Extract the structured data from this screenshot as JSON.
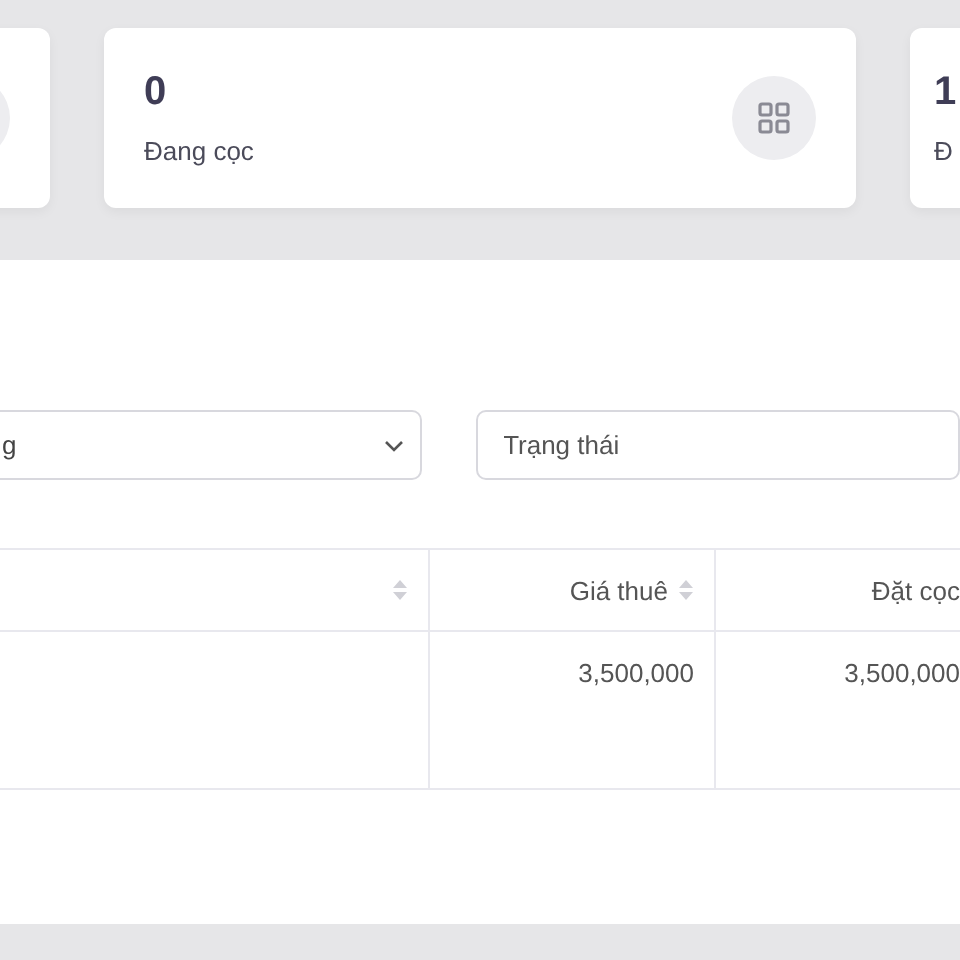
{
  "stat_cards": [
    {
      "kind": "icon_only"
    },
    {
      "kind": "with_icon",
      "value": "0",
      "label": "Đang cọc"
    },
    {
      "kind": "text_only",
      "value": "1",
      "label": "Đ"
    }
  ],
  "filters": [
    {
      "kind": "select",
      "value": "g"
    },
    {
      "kind": "input",
      "placeholder": "Trạng thái"
    }
  ],
  "table": {
    "columns": [
      {
        "sortable": true
      },
      {
        "label": "Giá thuê",
        "sortable": true
      },
      {
        "label": "Đặt cọc",
        "sortable": false
      }
    ],
    "rows": [
      [
        null,
        "3,500,000",
        "3,500,000"
      ]
    ]
  }
}
